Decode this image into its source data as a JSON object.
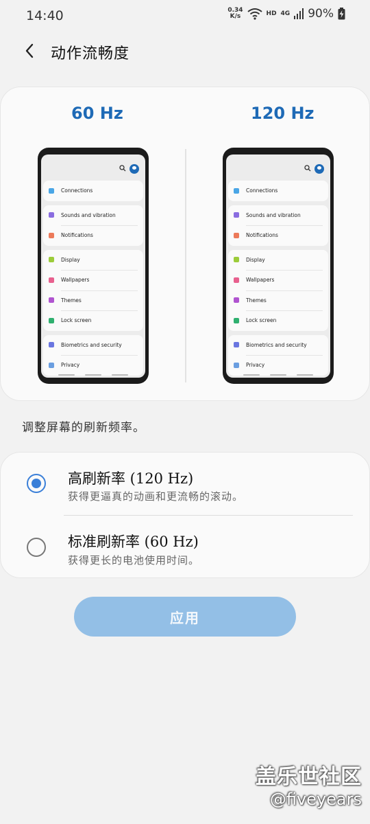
{
  "status_bar": {
    "time": "14:40",
    "net_speed_value": "0.34",
    "net_speed_unit": "K/s",
    "hd": "HD",
    "network": "4G",
    "battery": "90%"
  },
  "header": {
    "title": "动作流畅度",
    "back_icon": "chevron-left-icon"
  },
  "preview": {
    "left_label": "60 Hz",
    "right_label": "120 Hz",
    "settings_groups": [
      [
        {
          "label": "Connections",
          "icon": "wifi-icon",
          "color": "#4aa6e6"
        }
      ],
      [
        {
          "label": "Sounds and vibration",
          "icon": "speaker-icon",
          "color": "#8a6de0"
        },
        {
          "label": "Notifications",
          "icon": "bell-icon",
          "color": "#ec7a5a"
        }
      ],
      [
        {
          "label": "Display",
          "icon": "sun-icon",
          "color": "#9ccc3a"
        },
        {
          "label": "Wallpapers",
          "icon": "image-icon",
          "color": "#e8608e"
        },
        {
          "label": "Themes",
          "icon": "brush-icon",
          "color": "#b054d0"
        },
        {
          "label": "Lock screen",
          "icon": "lock-icon",
          "color": "#2fb06f"
        }
      ],
      [
        {
          "label": "Biometrics and security",
          "icon": "shield-icon",
          "color": "#6a76e0"
        },
        {
          "label": "Privacy",
          "icon": "privacy-icon",
          "color": "#6a9ee0"
        }
      ]
    ]
  },
  "description": "调整屏幕的刷新频率。",
  "options": [
    {
      "title": "高刷新率 (120 Hz)",
      "subtitle": "获得更逼真的动画和更流畅的滚动。",
      "selected": true
    },
    {
      "title": "标准刷新率 (60 Hz)",
      "subtitle": "获得更长的电池使用时间。",
      "selected": false
    }
  ],
  "apply_button": "应用",
  "watermark": {
    "cn": "盖乐世社区",
    "en": "@fiveyears"
  },
  "colors": {
    "accent": "#1e6ab6",
    "radio": "#3a7fd8",
    "apply_bg": "#93bfe6"
  }
}
